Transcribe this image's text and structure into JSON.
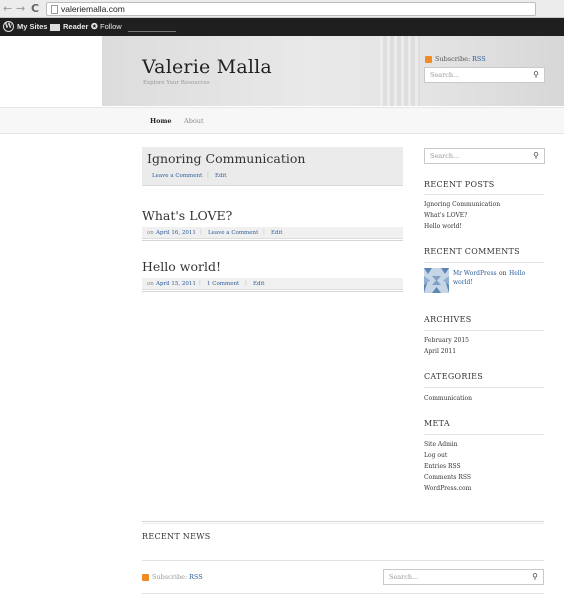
{
  "browser": {
    "back": "←",
    "forward": "→",
    "reload": "C",
    "url": "valeriemalla.com"
  },
  "admin_bar": {
    "my_sites": "My Sites",
    "reader": "Reader",
    "follow": "Follow"
  },
  "header": {
    "site_title": "Valerie Malla",
    "tagline": "Explore Your Resources",
    "subscribe_label": "Subscribe:",
    "subscribe_link": "RSS",
    "search_placeholder": "Search..."
  },
  "nav": {
    "items": [
      {
        "label": "Home",
        "active": true
      },
      {
        "label": "About",
        "active": false
      }
    ]
  },
  "posts": [
    {
      "title": "Ignoring Communication",
      "sticky": true,
      "meta_links": [
        "Leave a Comment",
        "Edit"
      ]
    },
    {
      "title": "What's LOVE?",
      "on": "on",
      "date": "April 16, 2011",
      "meta_links": [
        "Leave a Comment",
        "Edit"
      ]
    },
    {
      "title": "Hello world!",
      "on": "on",
      "date": "April 15, 2011",
      "meta_links": [
        "1 Comment",
        "Edit"
      ]
    }
  ],
  "sidebar": {
    "search_placeholder": "Search...",
    "recent_posts": {
      "heading": "RECENT POSTS",
      "items": [
        "Ignoring Communication",
        "What's LOVE?",
        "Hello world!"
      ]
    },
    "recent_comments": {
      "heading": "RECENT COMMENTS",
      "author": "Mr WordPress",
      "on": "on",
      "post_line1": "Hello",
      "post_line2": "world!"
    },
    "archives": {
      "heading": "ARCHIVES",
      "items": [
        "February 2015",
        "April 2011"
      ]
    },
    "categories": {
      "heading": "CATEGORIES",
      "items": [
        "Communication"
      ]
    },
    "meta": {
      "heading": "META",
      "items": [
        "Site Admin",
        "Log out",
        "Entries RSS",
        "Comments RSS",
        "WordPress.com"
      ]
    }
  },
  "footer": {
    "recent_news": "RECENT NEWS",
    "subscribe_label": "Subscribe:",
    "subscribe_link": "RSS",
    "search_placeholder": "Search..."
  },
  "colors": {
    "link": "#2a5b9a",
    "rss": "#f08a24",
    "admin_bar": "#1f1f1f"
  }
}
